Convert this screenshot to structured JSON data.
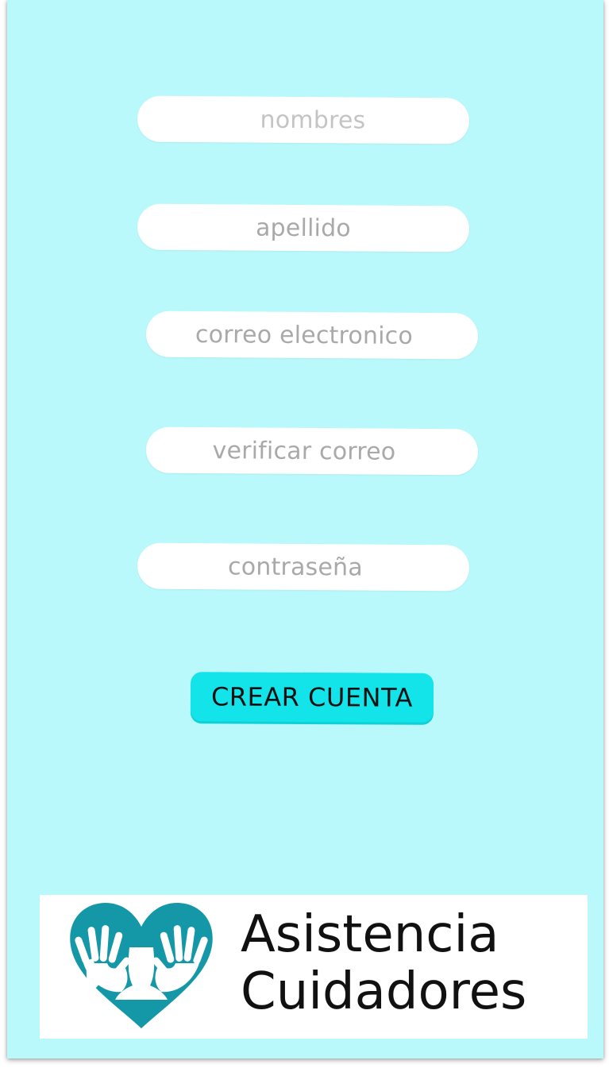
{
  "form": {
    "fields": [
      {
        "id": "nombres",
        "placeholder": "nombres"
      },
      {
        "id": "apellido",
        "placeholder": "apellido"
      },
      {
        "id": "correo",
        "placeholder": "correo electronico"
      },
      {
        "id": "verificar",
        "placeholder": "verificar correo"
      },
      {
        "id": "contrasena",
        "placeholder": "contraseña"
      }
    ],
    "submit_label": "CREAR CUENTA"
  },
  "logo": {
    "line1": "Asistencia",
    "line2": "Cuidadores",
    "icon": "heart-hands-icon"
  },
  "colors": {
    "background": "#baf9fb",
    "button": "#12e4ea",
    "logo_teal": "#1497a6",
    "placeholder_text": "#c4c4c4"
  }
}
